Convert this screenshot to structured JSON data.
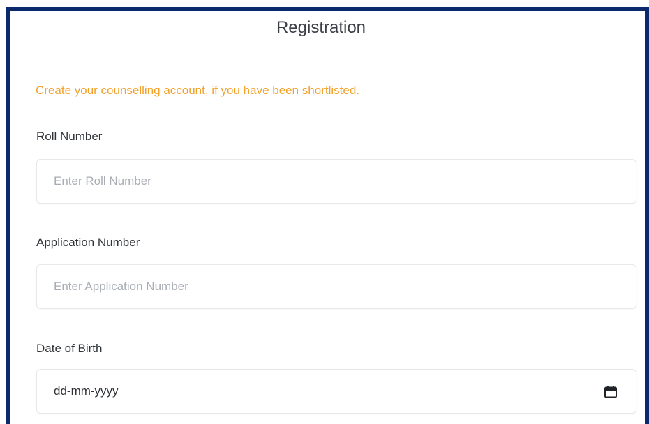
{
  "form": {
    "title": "Registration",
    "notice": "Create your counselling account, if you have been shortlisted.",
    "roll_number": {
      "label": "Roll Number",
      "placeholder": "Enter Roll Number",
      "value": ""
    },
    "application_number": {
      "label": "Application Number",
      "placeholder": "Enter Application Number",
      "value": ""
    },
    "date_of_birth": {
      "label": "Date of Birth",
      "display_value": "dd-mm-yyyy",
      "icon": "calendar-icon"
    }
  },
  "colors": {
    "frame_border": "#0b2a6e",
    "notice_text": "#f2a12a",
    "label_text": "#2f3337",
    "placeholder_text": "#a8adb4"
  }
}
